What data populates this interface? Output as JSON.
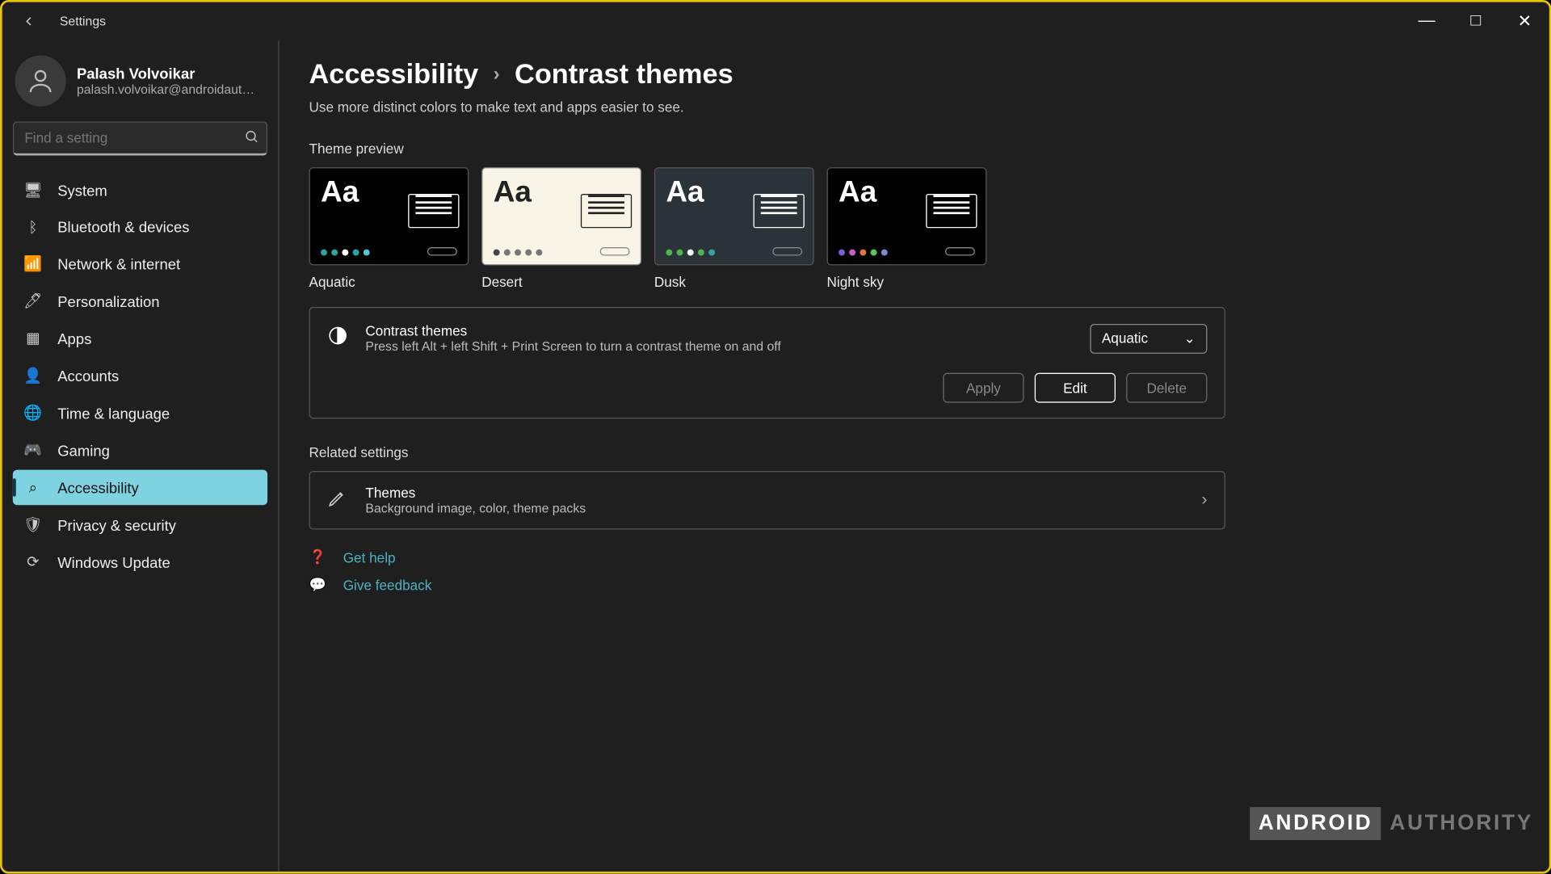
{
  "app_title": "Settings",
  "window_controls": {
    "min": "—",
    "max": "□",
    "close": "✕"
  },
  "user": {
    "name": "Palash Volvoikar",
    "email": "palash.volvoikar@androidauthority...."
  },
  "search": {
    "placeholder": "Find a setting"
  },
  "nav": [
    {
      "key": "system",
      "label": "System",
      "icon": "🖥"
    },
    {
      "key": "bluetooth",
      "label": "Bluetooth & devices",
      "icon": "ᛒ"
    },
    {
      "key": "network",
      "label": "Network & internet",
      "icon": "📶"
    },
    {
      "key": "personalization",
      "label": "Personalization",
      "icon": "🖊"
    },
    {
      "key": "apps",
      "label": "Apps",
      "icon": "▦"
    },
    {
      "key": "accounts",
      "label": "Accounts",
      "icon": "👤"
    },
    {
      "key": "time",
      "label": "Time & language",
      "icon": "🌐"
    },
    {
      "key": "gaming",
      "label": "Gaming",
      "icon": "🎮"
    },
    {
      "key": "accessibility",
      "label": "Accessibility",
      "icon": "⌕"
    },
    {
      "key": "privacy",
      "label": "Privacy & security",
      "icon": "🛡"
    },
    {
      "key": "update",
      "label": "Windows Update",
      "icon": "⟳"
    }
  ],
  "active_nav": "accessibility",
  "crumbs": {
    "parent": "Accessibility",
    "current": "Contrast themes"
  },
  "description": "Use more distinct colors to make text and apps easier to see.",
  "section_preview": "Theme preview",
  "themes": [
    {
      "name": "Aquatic",
      "style": "pv-aquatic",
      "dots": [
        "#2aa6a0",
        "#2aa6a0",
        "#fff",
        "#2aa6a0",
        "#53c7d6"
      ]
    },
    {
      "name": "Desert",
      "style": "pv-desert",
      "dots": [
        "#444",
        "#777",
        "#777",
        "#777",
        "#777"
      ]
    },
    {
      "name": "Dusk",
      "style": "pv-dusk",
      "dots": [
        "#4fb34f",
        "#4fb34f",
        "#fff",
        "#4fb34f",
        "#3aa0a0"
      ]
    },
    {
      "name": "Night sky",
      "style": "pv-night",
      "dots": [
        "#7a5cd6",
        "#c85ccf",
        "#e07a3a",
        "#5cc85c",
        "#7a8cd6"
      ]
    }
  ],
  "contrast_card": {
    "title": "Contrast themes",
    "subtitle": "Press left Alt + left Shift + Print Screen to turn a contrast theme on and off",
    "selected": "Aquatic",
    "apply": "Apply",
    "edit": "Edit",
    "delete": "Delete"
  },
  "section_related": "Related settings",
  "related": {
    "title": "Themes",
    "subtitle": "Background image, color, theme packs"
  },
  "links": {
    "help": "Get help",
    "feedback": "Give feedback"
  },
  "watermark": {
    "boxed": "ANDROID",
    "plain": "AUTHORITY"
  }
}
